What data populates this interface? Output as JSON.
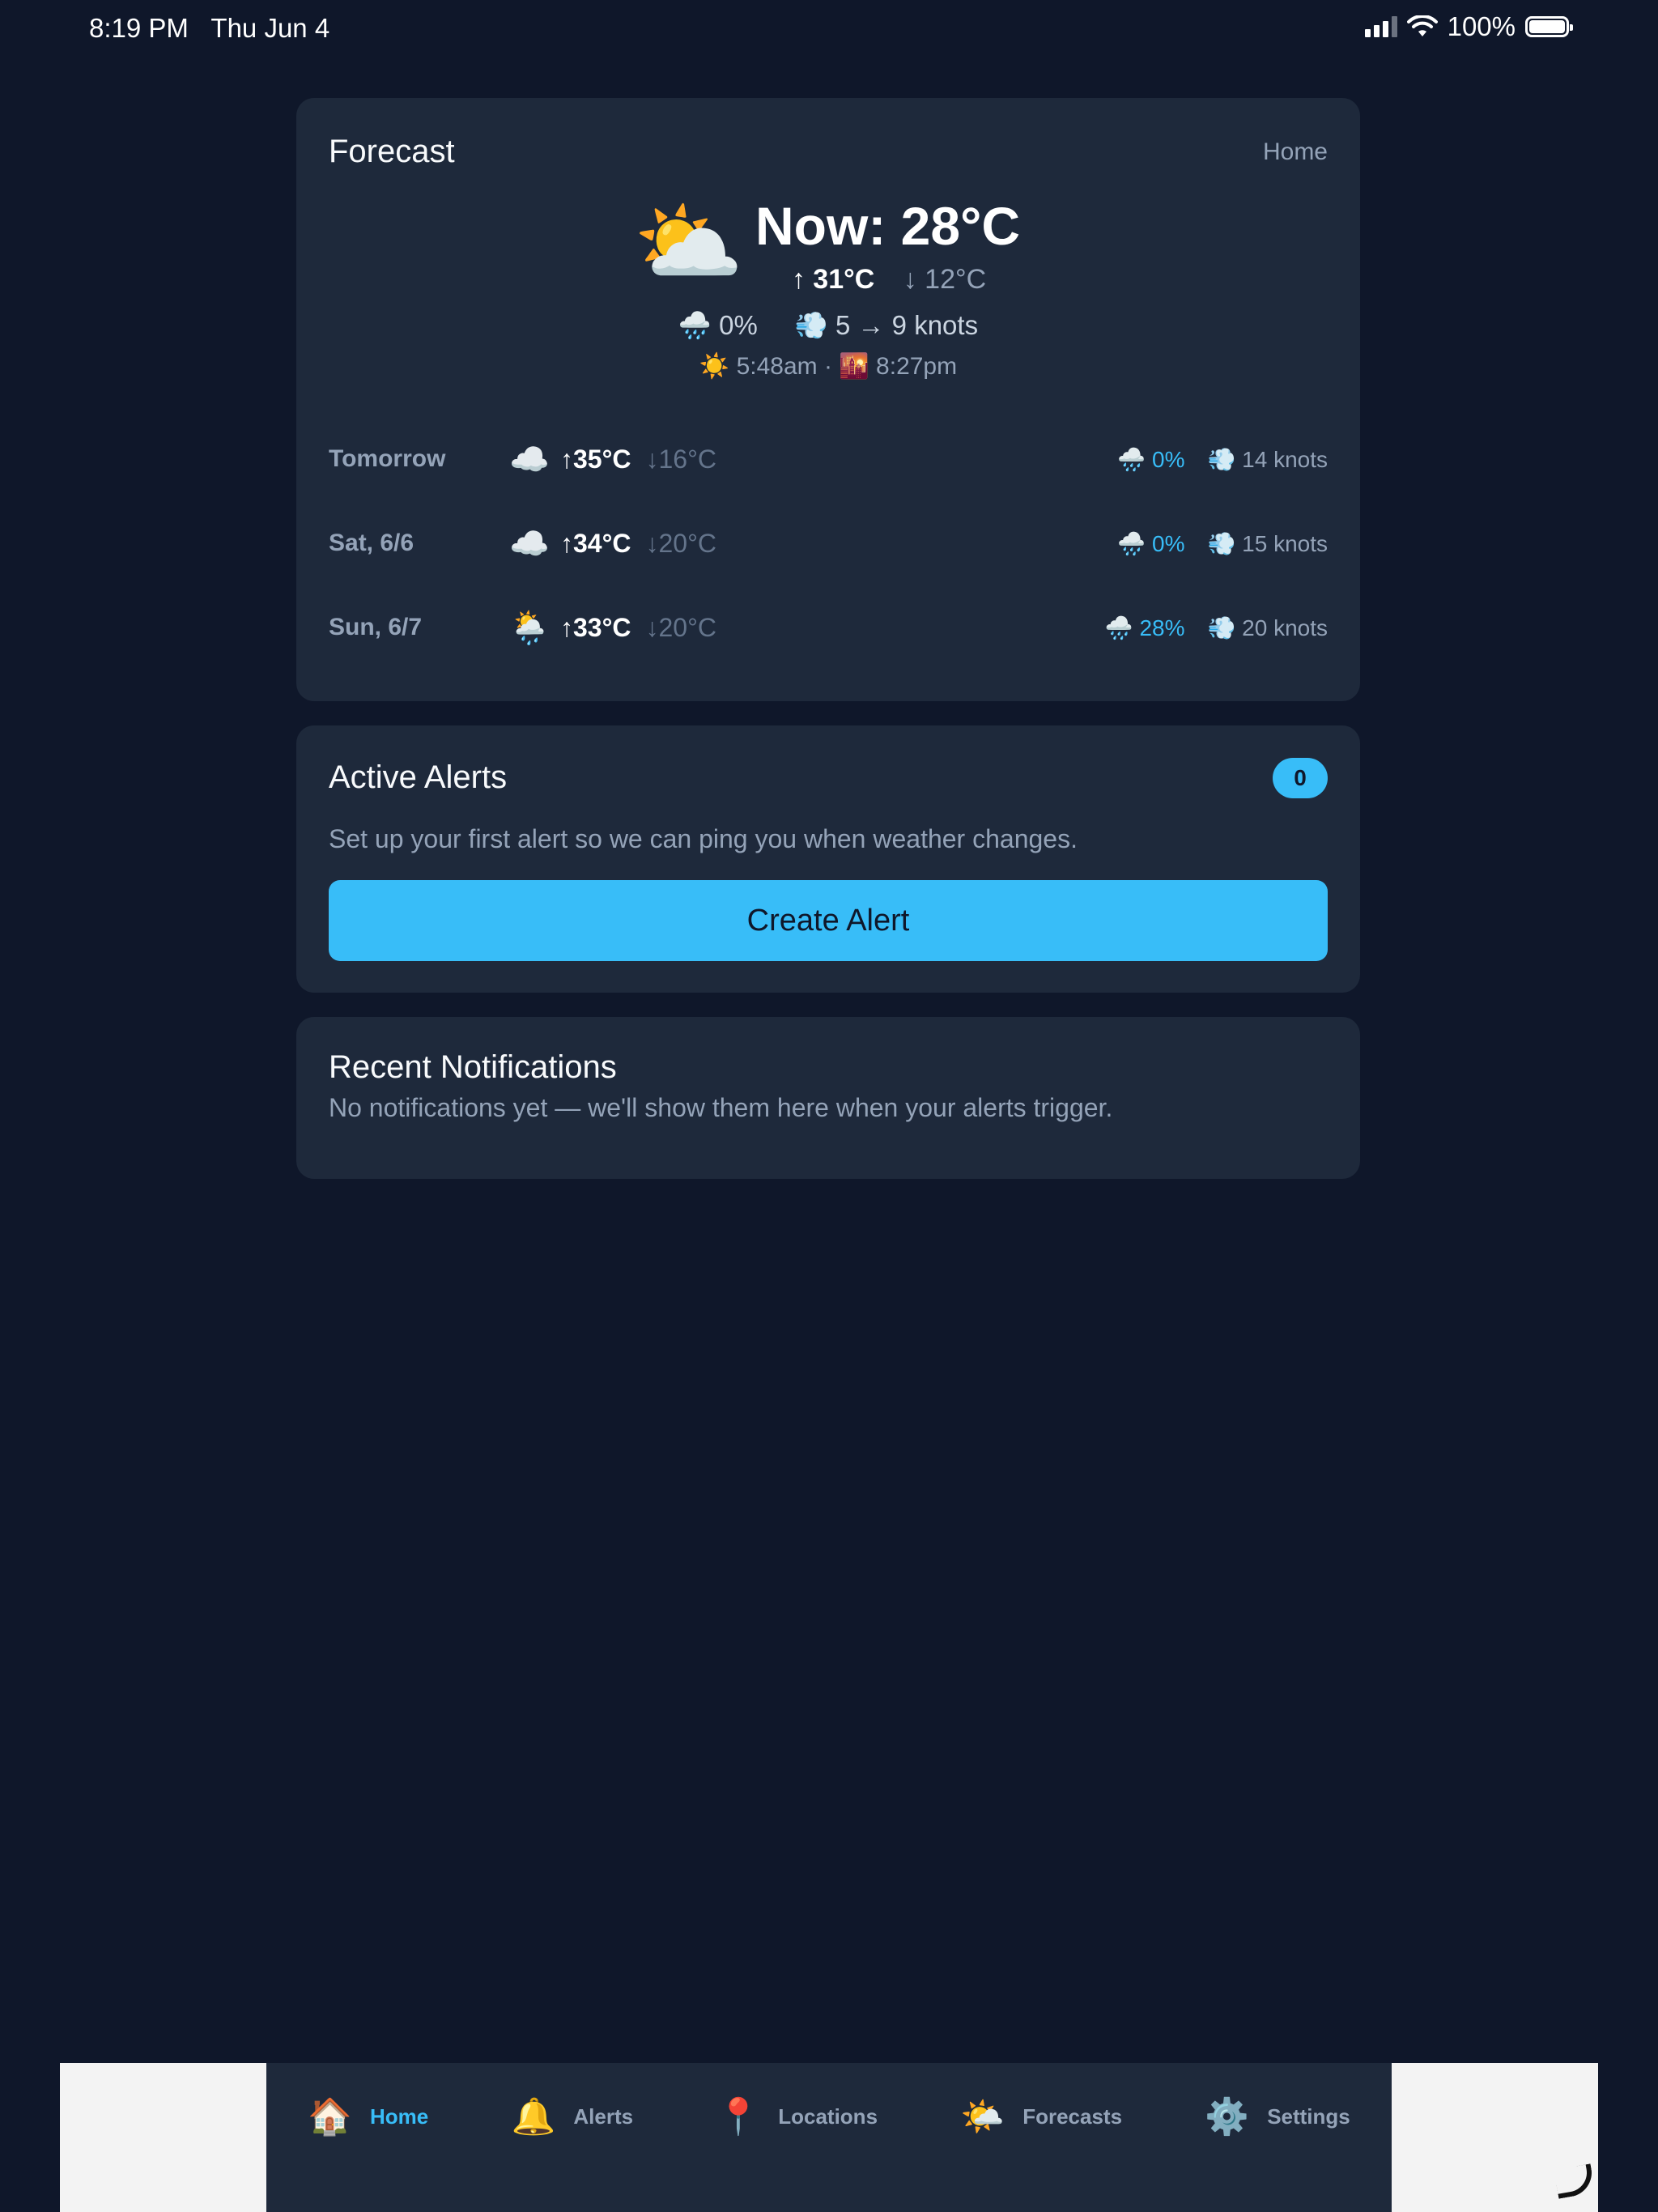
{
  "status": {
    "time": "8:19 PM",
    "date": "Thu Jun 4",
    "battery": "100%"
  },
  "forecast": {
    "title": "Forecast",
    "home_link": "Home",
    "now": {
      "icon": "⛅",
      "temp": "Now: 28°C",
      "high": "↑ 31°C",
      "low": "↓ 12°C",
      "rain_icon": "🌧️",
      "rain": "0%",
      "wind_icon": "💨",
      "wind": "5 → 9 knots",
      "sunrise_icon": "☀️",
      "sunrise": "5:48am",
      "sep": "·",
      "sunset_icon": "🌇",
      "sunset": "8:27pm"
    },
    "days": [
      {
        "day": "Tomorrow",
        "icon": "☁️",
        "high": "↑35°C",
        "low": "↓16°C",
        "rain": "0%",
        "wind": "14 knots"
      },
      {
        "day": "Sat, 6/6",
        "icon": "☁️",
        "high": "↑34°C",
        "low": "↓20°C",
        "rain": "0%",
        "wind": "15 knots"
      },
      {
        "day": "Sun, 6/7",
        "icon": "🌦️",
        "high": "↑33°C",
        "low": "↓20°C",
        "rain": "28%",
        "wind": "20 knots"
      }
    ],
    "rain_icon": "🌧️",
    "wind_icon": "💨"
  },
  "alerts": {
    "title": "Active Alerts",
    "count": "0",
    "description": "Set up your first alert so we can ping you when weather changes.",
    "button": "Create Alert"
  },
  "notifications": {
    "title": "Recent Notifications",
    "empty": "No notifications yet — we'll show them here when your alerts trigger."
  },
  "tabs": [
    {
      "icon": "🏠",
      "label": "Home"
    },
    {
      "icon": "🔔",
      "label": "Alerts"
    },
    {
      "icon": "📍",
      "label": "Locations"
    },
    {
      "icon": "🌤️",
      "label": "Forecasts"
    },
    {
      "icon": "⚙️",
      "label": "Settings"
    }
  ],
  "colors": {
    "background": "#0f172a",
    "card": "#1e293b",
    "accent": "#38bdf8"
  }
}
